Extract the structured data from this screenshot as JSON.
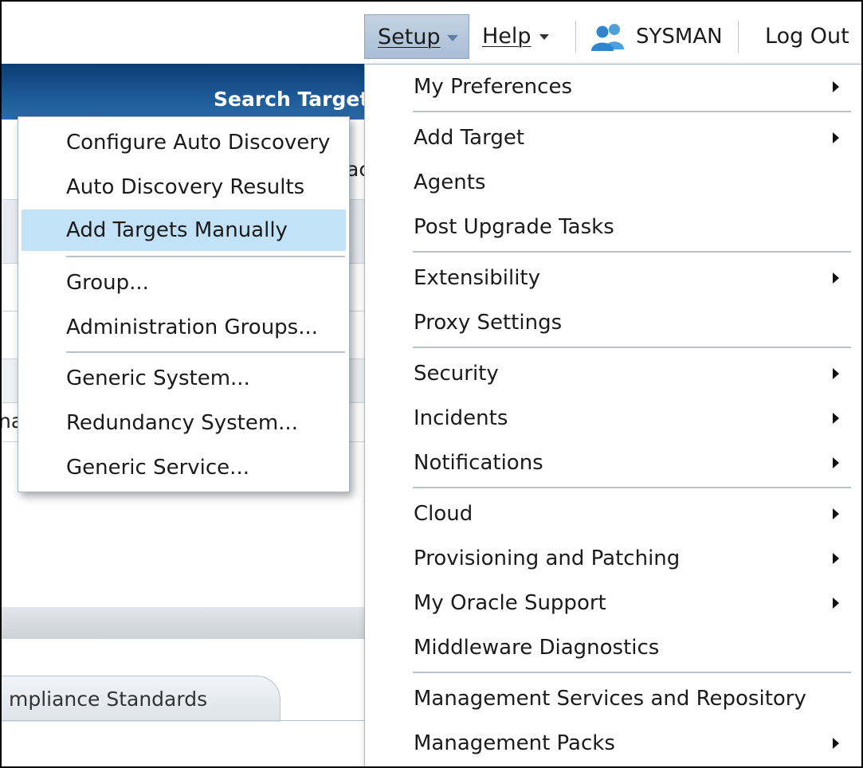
{
  "header": {
    "setup_label": "Setup",
    "help_label": "Help",
    "user_name": "SYSMAN",
    "logout_label": "Log Out"
  },
  "background": {
    "search_target_label": "Search Target",
    "tab_label": "mpliance Standards",
    "fragment_ac": "ac",
    "fragment_na": "na"
  },
  "setup_menu": {
    "items": [
      {
        "label": "My Preferences",
        "submenu": true
      },
      {
        "label": "Add Target",
        "submenu": true
      },
      {
        "label": "Agents",
        "submenu": false
      },
      {
        "label": "Post Upgrade Tasks",
        "submenu": false
      },
      {
        "label": "Extensibility",
        "submenu": true
      },
      {
        "label": "Proxy Settings",
        "submenu": false
      },
      {
        "label": "Security",
        "submenu": true
      },
      {
        "label": "Incidents",
        "submenu": true
      },
      {
        "label": "Notifications",
        "submenu": true
      },
      {
        "label": "Cloud",
        "submenu": true
      },
      {
        "label": "Provisioning and Patching",
        "submenu": true
      },
      {
        "label": "My Oracle Support",
        "submenu": true
      },
      {
        "label": "Middleware Diagnostics",
        "submenu": false
      },
      {
        "label": "Management Services and Repository",
        "submenu": false
      },
      {
        "label": "Management Packs",
        "submenu": true
      }
    ]
  },
  "add_target_menu": {
    "items": [
      {
        "label": "Configure Auto Discovery"
      },
      {
        "label": "Auto Discovery Results"
      },
      {
        "label": "Add Targets Manually",
        "highlighted": true
      },
      {
        "label": "Group..."
      },
      {
        "label": "Administration Groups..."
      },
      {
        "label": "Generic System..."
      },
      {
        "label": "Redundancy System..."
      },
      {
        "label": "Generic Service..."
      }
    ]
  },
  "colors": {
    "header_band": "#0b3d73",
    "setup_active_bg": "#b3c7dc",
    "menu_highlight": "#c2e2f7"
  }
}
